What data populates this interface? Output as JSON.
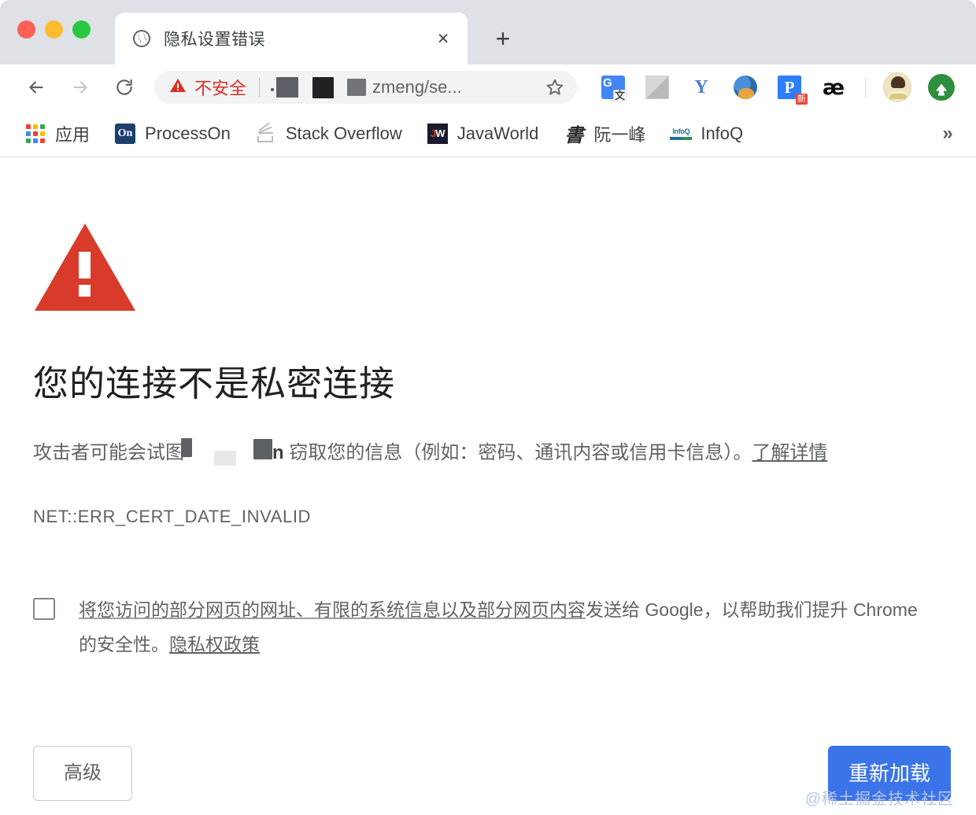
{
  "window": {
    "traffic_lights": [
      "close",
      "minimize",
      "zoom"
    ],
    "colors": {
      "close": "#ff5f57",
      "minimize": "#febc2e",
      "zoom": "#28c840",
      "tabstrip_bg": "#dee1e6",
      "warning_red": "#d93025",
      "primary_blue": "#3b74e8",
      "text_gray": "#5f6368",
      "heading_dark": "#202124"
    }
  },
  "tabs": [
    {
      "title": "隐私设置错误",
      "favicon": "globe-icon",
      "close_label": "×",
      "active": true
    }
  ],
  "new_tab_label": "+",
  "toolbar": {
    "back_icon": "back-arrow-icon",
    "forward_icon": "forward-arrow-icon",
    "reload_icon": "reload-icon",
    "security_label": "不安全",
    "security_icon": "warning-triangle-icon",
    "url_visible": "zmeng/se...",
    "url_redacted_blocks": 3,
    "bookmark_icon": "star-icon",
    "extensions": [
      {
        "name": "google-translate-extension-icon",
        "glyph": "G"
      },
      {
        "name": "gray-square-extension-icon",
        "glyph": ""
      },
      {
        "name": "y-extension-icon",
        "glyph": "Y"
      },
      {
        "name": "avatar-extension-icon",
        "glyph": ""
      },
      {
        "name": "p-new-extension-icon",
        "glyph": "P",
        "badge": "新"
      },
      {
        "name": "ae-extension-icon",
        "glyph": "æ"
      }
    ],
    "profile_icon": "user-profile-avatar",
    "update_icon": "upload-update-icon"
  },
  "bookmarks": {
    "items": [
      {
        "label": "应用",
        "icon": "apps-grid-icon"
      },
      {
        "label": "ProcessOn",
        "icon": "processon-icon"
      },
      {
        "label": "Stack Overflow",
        "icon": "stack-overflow-icon"
      },
      {
        "label": "JavaWorld",
        "icon": "javaworld-icon"
      },
      {
        "label": "阮一峰",
        "icon": "ruanyifeng-icon"
      },
      {
        "label": "InfoQ",
        "icon": "infoq-icon"
      }
    ],
    "overflow_label": "»"
  },
  "error_page": {
    "icon": "red-warning-triangle-icon",
    "title": "您的连接不是私密连接",
    "description_before": "攻击者可能会试图",
    "description_middle": "n",
    "description_after": " 窃取您的信息（例如：密码、通讯内容或信用卡信息）。",
    "learn_more": "了解详情",
    "error_code": "NET::ERR_CERT_DATE_INVALID",
    "optin": {
      "checked": false,
      "text_underlined": "将您访问的部分网页的网址、有限的系统信息以及部分网页内容",
      "text_rest": "发送给 Google，以帮助我们提升 Chrome 的安全性。",
      "privacy_link": "隐私权政策"
    },
    "advanced_button": "高级",
    "reload_button": "重新加载"
  },
  "watermark": "@稀土掘金技术社区"
}
